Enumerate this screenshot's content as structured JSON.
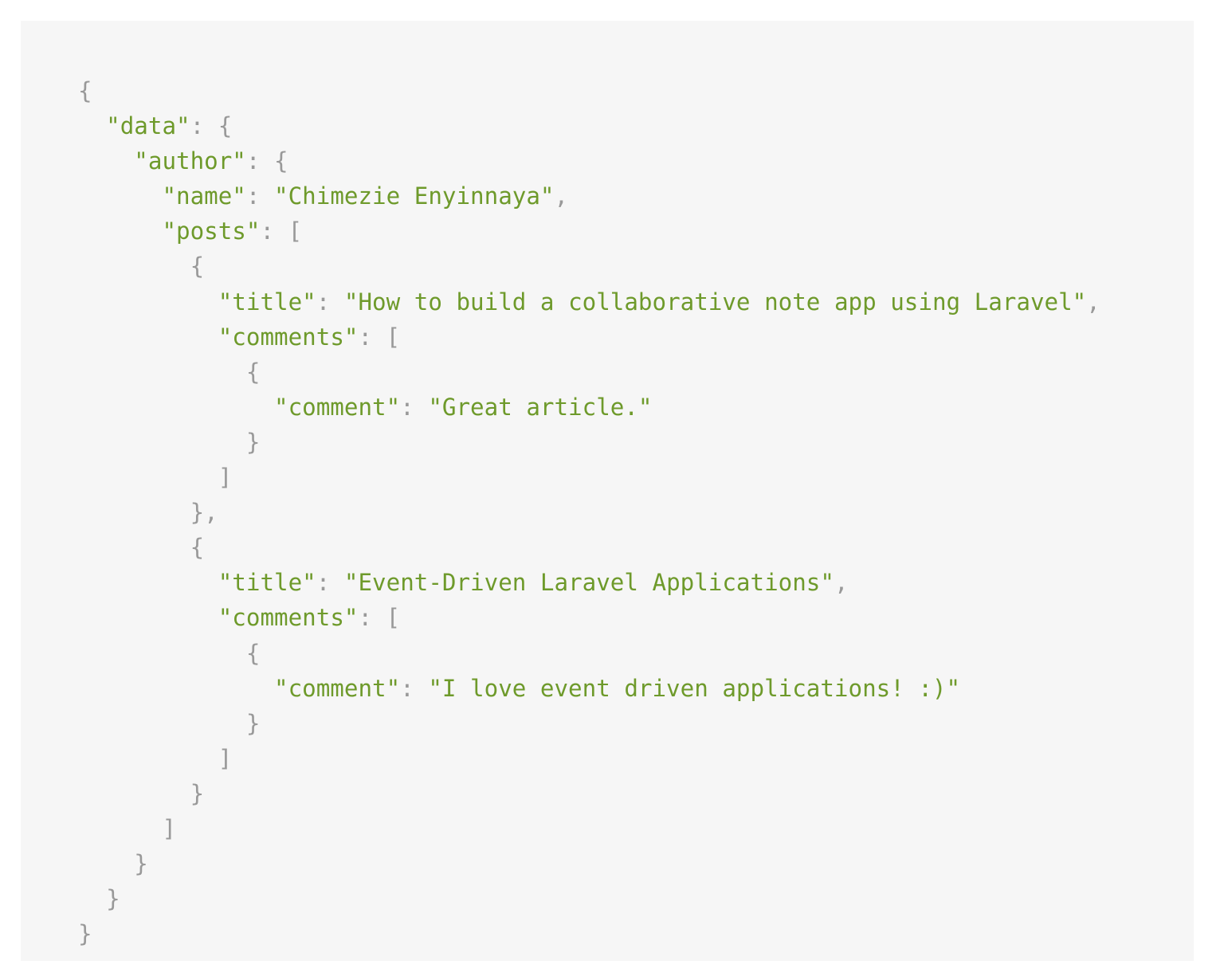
{
  "colors": {
    "background": "#ffffff",
    "panel": "#f6f6f6",
    "punctuation": "#999999",
    "string": "#6e9a2b"
  },
  "lines": [
    {
      "indent": "",
      "tokens": [
        {
          "t": "{",
          "c": "punct"
        }
      ]
    },
    {
      "indent": "  ",
      "tokens": [
        {
          "t": "\"data\"",
          "c": "str"
        },
        {
          "t": ": {",
          "c": "punct"
        }
      ]
    },
    {
      "indent": "    ",
      "tokens": [
        {
          "t": "\"author\"",
          "c": "str"
        },
        {
          "t": ": {",
          "c": "punct"
        }
      ]
    },
    {
      "indent": "      ",
      "tokens": [
        {
          "t": "\"name\"",
          "c": "str"
        },
        {
          "t": ": ",
          "c": "punct"
        },
        {
          "t": "\"Chimezie Enyinnaya\"",
          "c": "str"
        },
        {
          "t": ",",
          "c": "punct"
        }
      ]
    },
    {
      "indent": "      ",
      "tokens": [
        {
          "t": "\"posts\"",
          "c": "str"
        },
        {
          "t": ": [",
          "c": "punct"
        }
      ]
    },
    {
      "indent": "        ",
      "tokens": [
        {
          "t": "{",
          "c": "punct"
        }
      ]
    },
    {
      "indent": "          ",
      "tokens": [
        {
          "t": "\"title\"",
          "c": "str"
        },
        {
          "t": ": ",
          "c": "punct"
        },
        {
          "t": "\"How to build a collaborative note app using Laravel\"",
          "c": "str"
        },
        {
          "t": ",",
          "c": "punct"
        }
      ]
    },
    {
      "indent": "          ",
      "tokens": [
        {
          "t": "\"comments\"",
          "c": "str"
        },
        {
          "t": ": [",
          "c": "punct"
        }
      ]
    },
    {
      "indent": "            ",
      "tokens": [
        {
          "t": "{",
          "c": "punct"
        }
      ]
    },
    {
      "indent": "              ",
      "tokens": [
        {
          "t": "\"comment\"",
          "c": "str"
        },
        {
          "t": ": ",
          "c": "punct"
        },
        {
          "t": "\"Great article.\"",
          "c": "str"
        }
      ]
    },
    {
      "indent": "            ",
      "tokens": [
        {
          "t": "}",
          "c": "punct"
        }
      ]
    },
    {
      "indent": "          ",
      "tokens": [
        {
          "t": "]",
          "c": "punct"
        }
      ]
    },
    {
      "indent": "        ",
      "tokens": [
        {
          "t": "},",
          "c": "punct"
        }
      ]
    },
    {
      "indent": "        ",
      "tokens": [
        {
          "t": "{",
          "c": "punct"
        }
      ]
    },
    {
      "indent": "          ",
      "tokens": [
        {
          "t": "\"title\"",
          "c": "str"
        },
        {
          "t": ": ",
          "c": "punct"
        },
        {
          "t": "\"Event-Driven Laravel Applications\"",
          "c": "str"
        },
        {
          "t": ",",
          "c": "punct"
        }
      ]
    },
    {
      "indent": "          ",
      "tokens": [
        {
          "t": "\"comments\"",
          "c": "str"
        },
        {
          "t": ": [",
          "c": "punct"
        }
      ]
    },
    {
      "indent": "            ",
      "tokens": [
        {
          "t": "{",
          "c": "punct"
        }
      ]
    },
    {
      "indent": "              ",
      "tokens": [
        {
          "t": "\"comment\"",
          "c": "str"
        },
        {
          "t": ": ",
          "c": "punct"
        },
        {
          "t": "\"I love event driven applications! :)\"",
          "c": "str"
        }
      ]
    },
    {
      "indent": "            ",
      "tokens": [
        {
          "t": "}",
          "c": "punct"
        }
      ]
    },
    {
      "indent": "          ",
      "tokens": [
        {
          "t": "]",
          "c": "punct"
        }
      ]
    },
    {
      "indent": "        ",
      "tokens": [
        {
          "t": "}",
          "c": "punct"
        }
      ]
    },
    {
      "indent": "      ",
      "tokens": [
        {
          "t": "]",
          "c": "punct"
        }
      ]
    },
    {
      "indent": "    ",
      "tokens": [
        {
          "t": "}",
          "c": "punct"
        }
      ]
    },
    {
      "indent": "  ",
      "tokens": [
        {
          "t": "}",
          "c": "punct"
        }
      ]
    },
    {
      "indent": "",
      "tokens": [
        {
          "t": "}",
          "c": "punct"
        }
      ]
    }
  ]
}
